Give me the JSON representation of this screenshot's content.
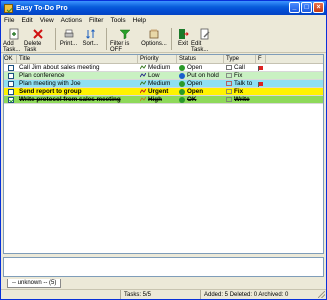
{
  "window": {
    "title": "Easy To-Do Pro"
  },
  "menu": [
    "File",
    "Edit",
    "View",
    "Actions",
    "Filter",
    "Tools",
    "Help"
  ],
  "toolbar": [
    {
      "label": "Add Task...",
      "icon": "add-task-icon",
      "color": "#2a7a2a"
    },
    {
      "label": "Delete Task",
      "icon": "delete-icon",
      "color": "#d01010"
    },
    {
      "label": "Print...",
      "icon": "print-icon",
      "color": "#555555"
    },
    {
      "label": "Sort...",
      "icon": "sort-icon",
      "color": "#1c5fbf"
    },
    {
      "label": "Filter is OFF",
      "icon": "filter-icon",
      "color": "#28a028"
    },
    {
      "label": "Options...",
      "icon": "options-icon",
      "color": "#7a5a30"
    },
    {
      "label": "Exit",
      "icon": "exit-icon",
      "color": "#1c7a2a"
    },
    {
      "label": "Edit Task...",
      "icon": "edit-task-icon",
      "color": "#6a6a6a"
    }
  ],
  "columns": [
    "OK",
    "Title",
    "Priority",
    "Status",
    "Type",
    "F"
  ],
  "tasks": [
    {
      "ok": false,
      "title": "Call Jim about sales meeting",
      "priority": "Medium",
      "status": "Open",
      "type": "Call",
      "flag": true,
      "bg": "#ffffff",
      "bold": false,
      "strike": false,
      "prio_color": "#3a7a20",
      "status_color": "#2a9a2a",
      "type_color": "#555555"
    },
    {
      "ok": false,
      "title": "Plan conference",
      "priority": "Low",
      "status": "Put on hold",
      "type": "Fix",
      "flag": false,
      "bg": "#c9f1c2",
      "bold": false,
      "strike": false,
      "prio_color": "#2a2a8a",
      "status_color": "#1a5fcc",
      "type_color": "#777777"
    },
    {
      "ok": false,
      "title": "Plan meeting with Joe",
      "priority": "Medium",
      "status": "Open",
      "type": "Talk to",
      "flag": true,
      "bg": "#8fe0f2",
      "bold": false,
      "strike": false,
      "prio_color": "#3a7a20",
      "status_color": "#2a9a2a",
      "type_color": "#c04040"
    },
    {
      "ok": false,
      "title": "Send report to group",
      "priority": "Urgent",
      "status": "Open",
      "type": "Fix",
      "flag": false,
      "bg": "#fff200",
      "bold": true,
      "strike": false,
      "prio_color": "#c02020",
      "status_color": "#2a9a2a",
      "type_color": "#777777"
    },
    {
      "ok": true,
      "title": "Write protocol from sales meeting",
      "priority": "High",
      "status": "OK",
      "type": "Write",
      "flag": false,
      "bg": "#8ed95a",
      "bold": true,
      "strike": true,
      "prio_color": "#c08020",
      "status_color": "#2a9a2a",
      "type_color": "#777777"
    }
  ],
  "tabs": [
    {
      "label": "-- unknown -- (5)"
    }
  ],
  "status": {
    "tasks": "Tasks: 5/5",
    "counts": "Added: 5 Deleted: 0 Archived: 0"
  }
}
